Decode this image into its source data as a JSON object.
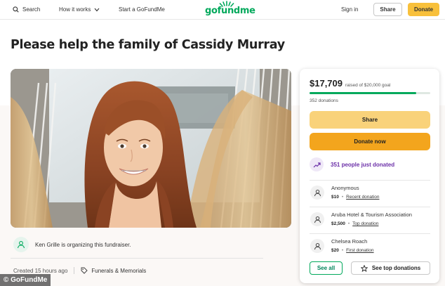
{
  "nav": {
    "search_label": "Search",
    "how_it_works_label": "How it works",
    "start_label": "Start a GoFundMe",
    "logo_text": "gofundme",
    "signin_label": "Sign in",
    "share_label": "Share",
    "donate_label": "Donate"
  },
  "campaign": {
    "title": "Please help the family of Cassidy Murray",
    "organizer_text": "Ken Grille is organizing this fundraiser.",
    "created_text": "Created 15 hours ago",
    "category": "Funerals & Memorials"
  },
  "card": {
    "raised_amount": "$17,709",
    "goal_text": "raised of $20,000 goal",
    "progress_fraction": 0.885,
    "donations_count": "352 donations",
    "share_label": "Share",
    "donate_label": "Donate now",
    "trend_text": "351 people just donated",
    "donors": [
      {
        "name": "Anonymous",
        "amount": "$10",
        "tag": "Recent donation"
      },
      {
        "name": "Aruba Hotel & Tourism Association",
        "amount": "$2,500",
        "tag": "Top donation"
      },
      {
        "name": "Chelsea Roach",
        "amount": "$20",
        "tag": "First donation"
      }
    ],
    "see_all_label": "See all",
    "top_donations_label": "See top donations"
  },
  "watermark": "© GoFundMe",
  "colors": {
    "brand_green": "#02a95c",
    "share_yellow": "#f9d27a",
    "donate_orange": "#f3a51d",
    "trend_purple": "#6b2fa8"
  },
  "icons": [
    "search-icon",
    "chevron-down-icon",
    "sun-icon",
    "person-icon",
    "tag-icon",
    "trend-up-icon",
    "star-icon"
  ]
}
